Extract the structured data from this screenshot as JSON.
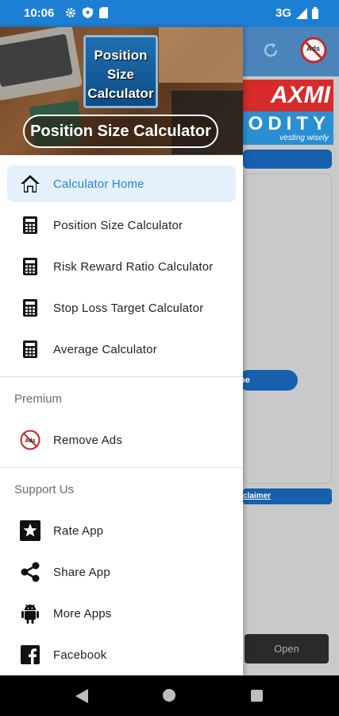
{
  "status_bar": {
    "time": "10:06",
    "network": "3G"
  },
  "header": {
    "logo_line1": "Position",
    "logo_line2": "Size",
    "logo_line3": "Calculator",
    "title": "Position Size Calculator"
  },
  "menu": {
    "main": [
      {
        "label": "Calculator Home",
        "icon": "home-icon",
        "active": true
      },
      {
        "label": "Position Size Calculator",
        "icon": "calculator-icon"
      },
      {
        "label": "Risk Reward Ratio Calculator",
        "icon": "calculator-icon"
      },
      {
        "label": "Stop Loss Target Calculator",
        "icon": "calculator-icon"
      },
      {
        "label": "Average Calculator",
        "icon": "calculator-icon"
      }
    ],
    "premium_title": "Premium",
    "premium": [
      {
        "label": "Remove Ads",
        "icon": "no-ads-icon"
      }
    ],
    "support_title": "Support Us",
    "support": [
      {
        "label": "Rate App",
        "icon": "star-icon"
      },
      {
        "label": "Share App",
        "icon": "share-icon"
      },
      {
        "label": "More Apps",
        "icon": "android-icon"
      },
      {
        "label": "Facebook",
        "icon": "facebook-icon"
      }
    ]
  },
  "background": {
    "banner_red": "AXMI",
    "banner_blue": "ODITY",
    "banner_tagline": "vesting wisely",
    "pill_fragment": "pe",
    "disclaimer_fragment": "claimer",
    "open_button": "Open",
    "noads_badge": "Ads"
  },
  "colors": {
    "accent": "#1f86d6",
    "status_bar": "#1d7fd4",
    "active_bg": "#e4f0fb"
  }
}
